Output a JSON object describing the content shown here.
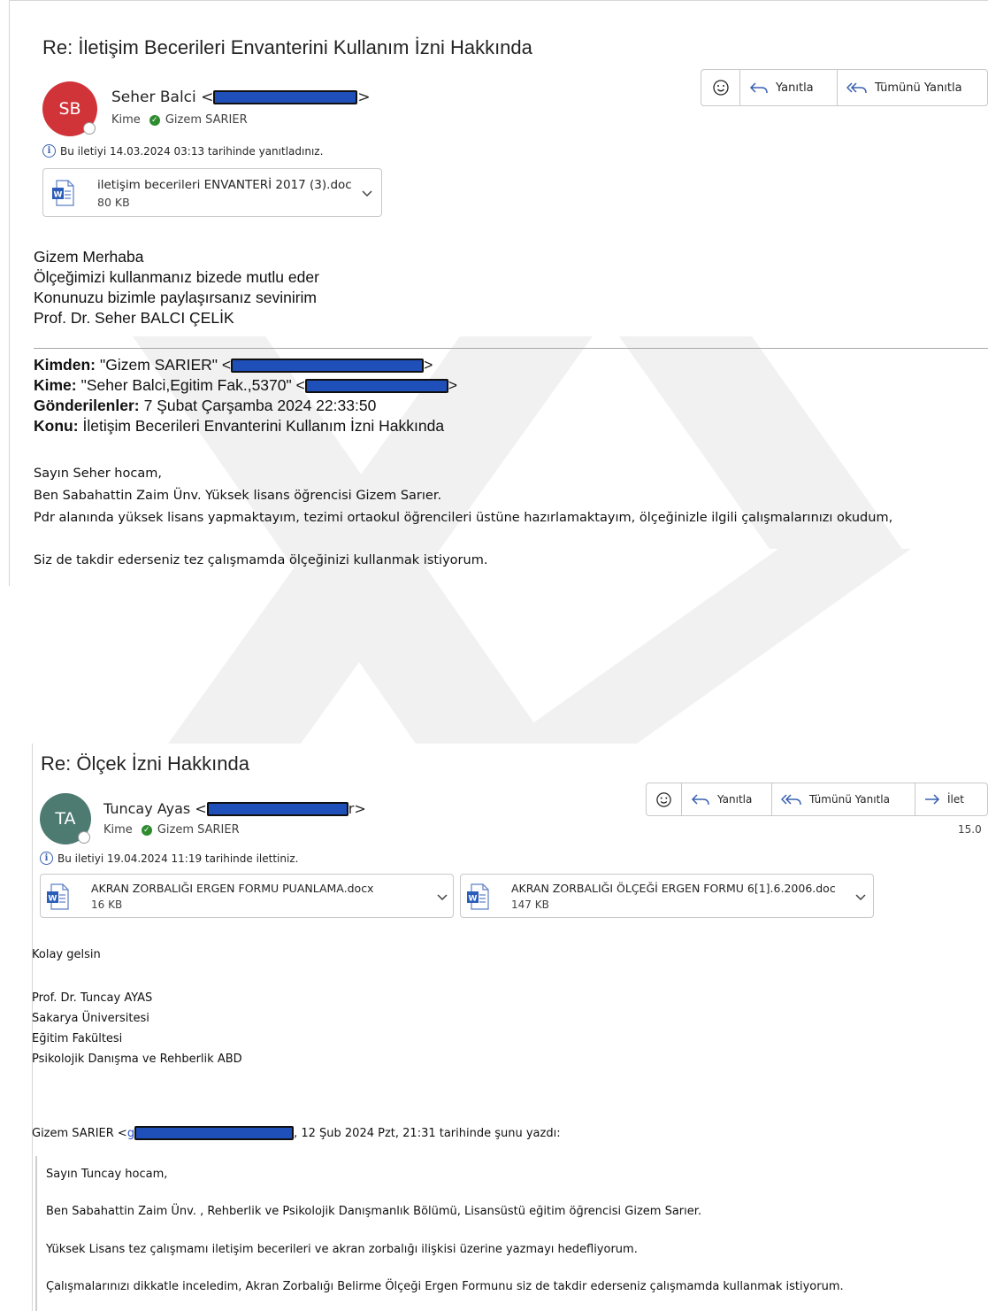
{
  "email1": {
    "subject": "Re: İletişim Becerileri Envanterini Kullanım İzni Hakkında",
    "avatar_initials": "SB",
    "avatar_color": "#d13438",
    "sender_name": "Seher Balci <",
    "sender_close": ">",
    "to_label": "Kime",
    "to_name": "Gizem SARIER",
    "info": "Bu iletiyi 14.03.2024 03:13 tarihinde yanıtladınız.",
    "attachment": {
      "name": "iletişim becerileri ENVANTERİ 2017 (3).doc",
      "size": "80 KB"
    },
    "toolbar": {
      "reply": "Yanıtla",
      "reply_all": "Tümünü Yanıtla"
    },
    "body_lines": [
      "Gizem Merhaba",
      "Ölçeğimizi kullanmanız bizede mutlu eder",
      "Konunuzu bizimle paylaşırsanız sevinirim",
      "Prof. Dr. Seher BALCI ÇELİK"
    ],
    "quoted_header": {
      "from_label": "Kimden:",
      "from_value": "\"Gizem SARIER\" <",
      "to_label": "Kime:",
      "to_value": "\"Seher Balci,Egitim Fak.,5370\" <",
      "sent_label": "Gönderilenler:",
      "sent_value": "7 Şubat Çarşamba 2024 22:33:50",
      "subject_label": "Konu:",
      "subject_value": "İletişim Becerileri Envanterini Kullanım İzni Hakkında"
    },
    "quoted_lines": [
      "Sayın Seher hocam,",
      "Ben Sabahattin Zaim Ünv. Yüksek lisans öğrencisi Gizem Sarıer.",
      "Pdr alanında yüksek lisans yapmaktayım, tezimi ortaokul öğrencileri üstüne hazırlamaktayım, ölçeğinizle ilgili çalışmalarınızı okudum,",
      "Siz de takdir ederseniz tez çalışmamda ölçeğinizi kullanmak istiyorum."
    ]
  },
  "email2": {
    "subject": "Re: Ölçek İzni Hakkında",
    "avatar_initials": "TA",
    "avatar_color": "#4d7b71",
    "sender_name": "Tuncay Ayas <",
    "sender_close": "r>",
    "to_label": "Kime",
    "to_name": "Gizem SARIER",
    "info": "Bu iletiyi 19.04.2024 11:19 tarihinde ilettiniz.",
    "date_partial": "15.0",
    "attachments": [
      {
        "name": "AKRAN ZORBALIĞI ERGEN FORMU PUANLAMA.docx",
        "size": "16 KB"
      },
      {
        "name": "AKRAN ZORBALIĞI ÖLÇEĞİ  ERGEN FORMU 6[1].6.2006.doc",
        "size": "147 KB"
      }
    ],
    "toolbar": {
      "reply": "Yanıtla",
      "reply_all": "Tümünü Yanıtla",
      "forward": "İlet"
    },
    "greeting": "Kolay gelsin",
    "signature": [
      "Prof. Dr. Tuncay AYAS",
      "Sakarya Üniversitesi",
      "Eğitim Fakültesi",
      "Psikolojik Danışma ve Rehberlik ABD"
    ],
    "quote_intro_name": "Gizem SARIER <",
    "quote_link_char": "g",
    "quote_intro_rest": ", 12 Şub 2024 Pzt, 21:31 tarihinde şunu yazdı:",
    "quoted_lines": [
      "Sayın Tuncay hocam,",
      "Ben Sabahattin Zaim Ünv. , Rehberlik ve Psikolojik Danışmanlık Bölümü, Lisansüstü eğitim öğrencisi Gizem Sarıer.",
      "Yüksek Lisans tez çalışmamı iletişim becerileri ve akran zorbalığı ilişkisi üzerine yazmayı hedefliyorum.",
      "Çalışmalarınızı dikkatle inceledim, Akran Zorbalığı Belirme Ölçeği Ergen Formunu siz de takdir ederseniz çalışmamda kullanmak istiyorum."
    ]
  }
}
